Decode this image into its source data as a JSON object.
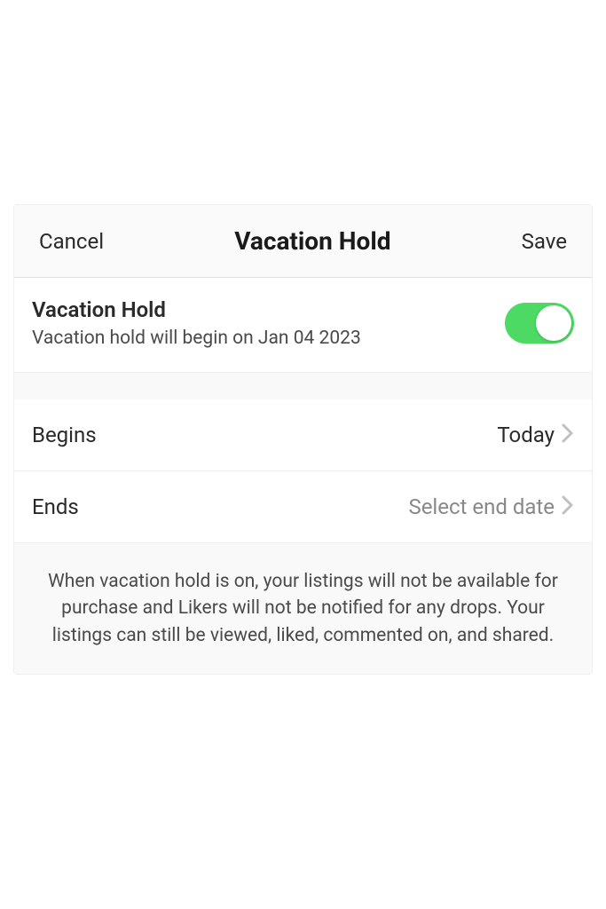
{
  "header": {
    "cancel_label": "Cancel",
    "title": "Vacation Hold",
    "save_label": "Save"
  },
  "toggle": {
    "title": "Vacation Hold",
    "subtitle": "Vacation hold will begin on Jan 04 2023",
    "enabled": true
  },
  "rows": {
    "begins": {
      "label": "Begins",
      "value": "Today"
    },
    "ends": {
      "label": "Ends",
      "value": "Select end date"
    }
  },
  "info": "When vacation hold is on, your listings will not be available for purchase and Likers will not be notified for any drops. Your listings can still be viewed, liked, commented on, and shared."
}
